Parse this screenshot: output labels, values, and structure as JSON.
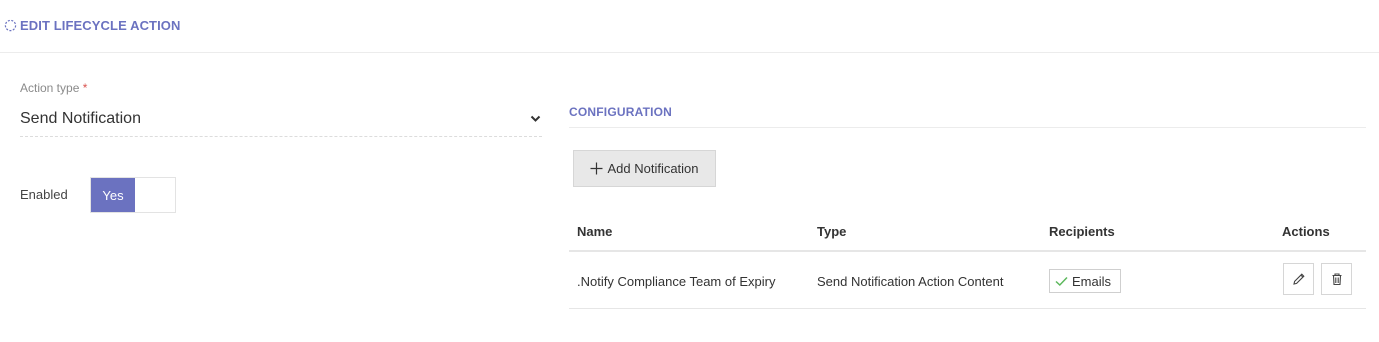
{
  "header": {
    "title": "EDIT LIFECYCLE ACTION",
    "icon": "refresh-icon"
  },
  "action_type": {
    "label": "Action type",
    "required_mark": "*",
    "value": "Send Notification"
  },
  "enabled": {
    "label": "Enabled",
    "toggle_value": "Yes"
  },
  "configuration": {
    "title": "CONFIGURATION",
    "add_button_label": "Add Notification",
    "table": {
      "columns": [
        "Name",
        "Type",
        "Recipients",
        "Actions"
      ],
      "rows": [
        {
          "name": ".Notify Compliance Team of Expiry",
          "type": "Send Notification Action Content",
          "recipients": "Emails"
        }
      ]
    }
  },
  "colors": {
    "accent": "#6b72c0",
    "toggle_on": "#6b72c0",
    "check": "#5cb85c",
    "required": "#d9534f"
  }
}
